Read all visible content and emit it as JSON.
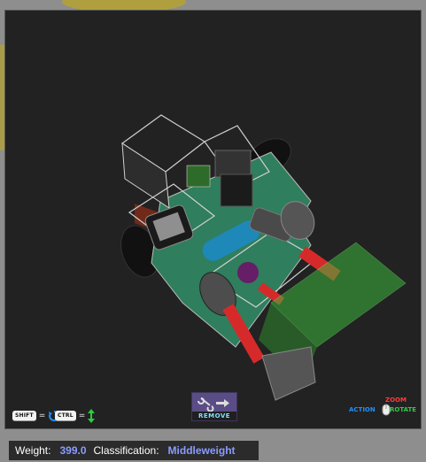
{
  "viewport": {
    "background": "#222222"
  },
  "hints": {
    "shift_key": "SHIFT",
    "ctrl_key": "CTRL",
    "equals": "=",
    "shift_icon": "rotate-arrow-icon",
    "ctrl_icon": "vertical-arrow-icon"
  },
  "remove_button": {
    "label": "REMOVE",
    "icon": "wrench-arrow-icon"
  },
  "mouse_legend": {
    "zoom": "ZOOM",
    "action": "ACTION",
    "rotate": "ROTATE",
    "icon": "mouse-icon",
    "colors": {
      "zoom": "#ff3b3b",
      "action": "#1e90ff",
      "rotate": "#2ecc40"
    }
  },
  "status": {
    "weight_label": "Weight:",
    "weight_value": "399.0",
    "class_label": "Classification:",
    "class_value": "Middleweight",
    "value_color": "#8a9cff"
  }
}
